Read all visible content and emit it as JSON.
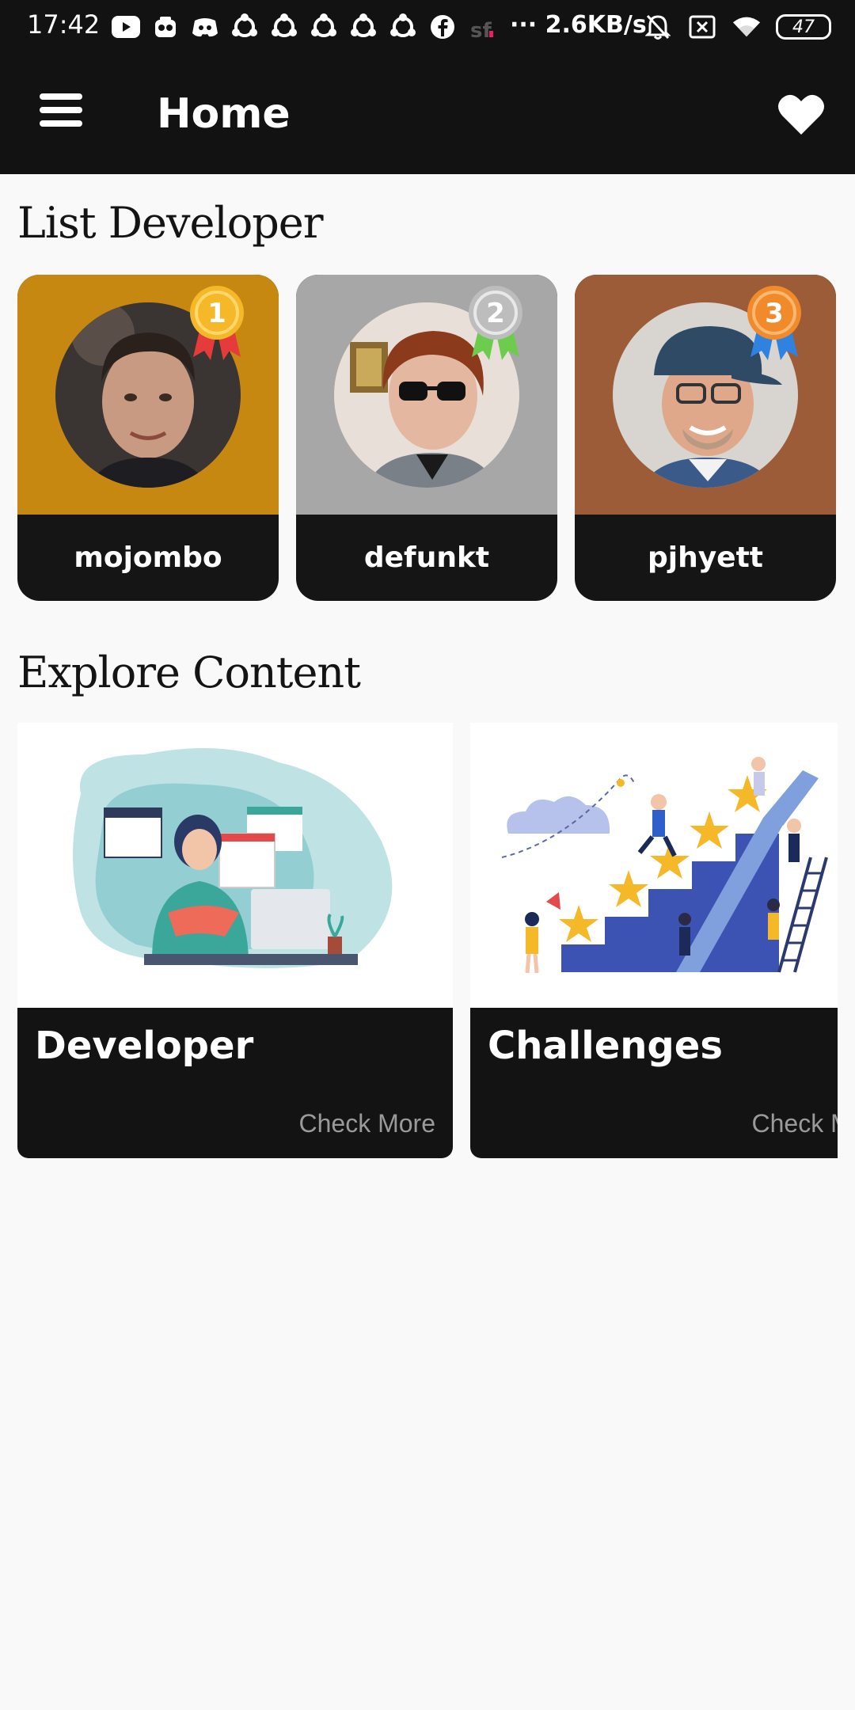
{
  "status_bar": {
    "time": "17:42",
    "speed": "··· 2.6KB/s",
    "battery": "47",
    "icons": [
      "youtube-icon",
      "camera-app-icon",
      "discord-icon",
      "sync-icon",
      "sync-icon",
      "sync-icon",
      "sync-icon",
      "sync-icon",
      "facebook-icon",
      "sf-icon",
      "bell-off-icon",
      "sim-off-icon",
      "wifi-icon",
      "battery-icon"
    ]
  },
  "app_bar": {
    "title": "Home",
    "menu_icon": "menu-icon",
    "favorite_icon": "heart-icon"
  },
  "sections": {
    "developers_title": "List Developer",
    "explore_title": "Explore Content"
  },
  "developers": [
    {
      "name": "mojombo",
      "rank": "1",
      "card_color": "#c78812",
      "medal_color": "#f5b829",
      "ribbon_color": "#e63b3b"
    },
    {
      "name": "defunkt",
      "rank": "2",
      "card_color": "#a7a7a7",
      "medal_color": "#bdbdbd",
      "ribbon_color": "#6dcc4e"
    },
    {
      "name": "pjhyett",
      "rank": "3",
      "card_color": "#9b5c37",
      "medal_color": "#f08a2a",
      "ribbon_color": "#2f82e0"
    }
  ],
  "explore": [
    {
      "title": "Developer",
      "more": "Check More"
    },
    {
      "title": "Challenges",
      "more": "Check More"
    }
  ]
}
